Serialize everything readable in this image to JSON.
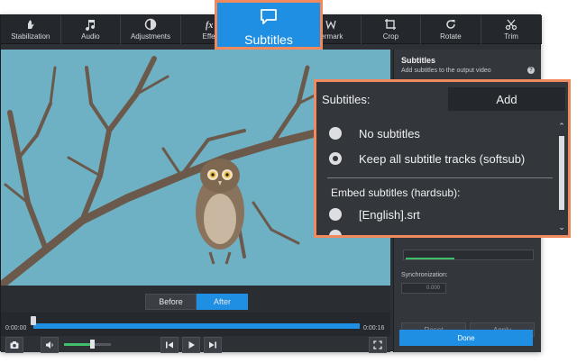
{
  "toolbar": {
    "tools": [
      {
        "label": "Stabilization",
        "icon": "stabilization-icon"
      },
      {
        "label": "Audio",
        "icon": "music-note-icon"
      },
      {
        "label": "Adjustments",
        "icon": "adjustments-icon"
      },
      {
        "label": "Effec",
        "icon": "effects-icon"
      },
      {
        "label": "",
        "icon": "subtitles-icon"
      },
      {
        "label": "termark",
        "icon": "watermark-icon"
      },
      {
        "label": "Crop",
        "icon": "crop-icon"
      },
      {
        "label": "Rotate",
        "icon": "rotate-icon"
      },
      {
        "label": "Trim",
        "icon": "scissors-icon"
      }
    ]
  },
  "subtitles_tab": {
    "label": "Subtitles",
    "icon": "speech-bubble-icon"
  },
  "preview": {
    "before_label": "Before",
    "after_label": "After",
    "active": "After"
  },
  "timeline": {
    "start_time": "0:00:00",
    "end_time": "0:00:16"
  },
  "controls": {
    "volume": 0.6,
    "icons": [
      "camera-icon",
      "speaker-icon",
      "previous-frame-icon",
      "play-icon",
      "next-frame-icon",
      "fullscreen-icon"
    ]
  },
  "panel": {
    "title": "Subtitles",
    "description": "Add subtitles to the output video",
    "help": "?",
    "sync_label": "Synchronization:",
    "sync_value": "0.000",
    "reset_label": "Reset",
    "apply_label": "Apply",
    "done_label": "Done"
  },
  "callout": {
    "label": "Subtitles:",
    "add_label": "Add",
    "options": [
      {
        "label": "No subtitles",
        "selected": false
      },
      {
        "label": "Keep all subtitle tracks (softsub)",
        "selected": true
      }
    ],
    "group_label": "Embed subtitles (hardsub):",
    "group_options": [
      {
        "label": "[English].srt",
        "selected": false
      }
    ]
  },
  "colors": {
    "accent": "#1f8fe3",
    "highlight_border": "#f08a5e",
    "volume_fill": "#3fbf6a",
    "video_sky": "#6fb1c4"
  }
}
